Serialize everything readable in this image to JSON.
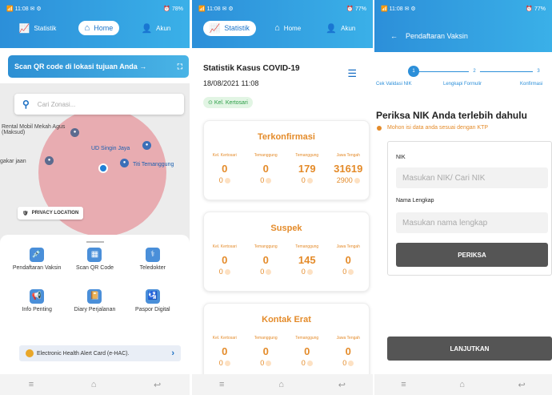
{
  "status": {
    "p1_left": "📶 11:08 ✉ ⚙",
    "p1_right": "⏰ 78%",
    "p2_left": "📶 11:08 ✉ ⚙",
    "p2_right": "⏰ 77%",
    "p3_left": "📶 11:08 ✉ ⚙",
    "p3_right": "⏰ 77%"
  },
  "nav": {
    "statistik": "Statistik",
    "home": "Home",
    "akun": "Akun"
  },
  "home": {
    "qr_label": "Scan QR code di lokasi tujuan Anda →",
    "search_placeholder": "Cari Zonasi...",
    "map_labels": [
      "Rental Mobil Mekah Agus (Maksud)",
      "UD Singin Jaya",
      "gakar jaan",
      "Titi Temanggung"
    ],
    "privacy": "PRIVACY LOCATION",
    "menu": [
      "Pendaftaran Vaksin",
      "Scan QR Code",
      "Teledokter",
      "Info Penting",
      "Diary Perjalanan",
      "Paspor Digital"
    ],
    "ehac": "Electronic Health Alert Card (e-HAC).",
    "ehac_arrow": "›"
  },
  "stats": {
    "title": "Statistik Kasus COVID-19",
    "date": "18/08/2021 11:08",
    "location": "Kel. Kertosari",
    "col_labels": [
      "Kel. Kertosari",
      "Temanggung",
      "Temanggung",
      "Jawa Tengah"
    ],
    "cards": [
      {
        "title": "Terkonfirmasi",
        "big": [
          "0",
          "0",
          "179",
          "31619"
        ],
        "small": [
          "0",
          "0",
          "0",
          "2900"
        ]
      },
      {
        "title": "Suspek",
        "big": [
          "0",
          "0",
          "145",
          "0"
        ],
        "small": [
          "0",
          "0",
          "0",
          "0"
        ]
      },
      {
        "title": "Kontak Erat",
        "big": [
          "0",
          "0",
          "0",
          "0"
        ],
        "small": [
          "0",
          "0",
          "0",
          "0"
        ]
      }
    ]
  },
  "vaksin": {
    "header": "Pendaftaran Vaksin",
    "steps": [
      "Cek Validasi NIK",
      "Lengkapi Formulir",
      "Konfirmasi"
    ],
    "step_nums": [
      "1",
      "2",
      "3"
    ],
    "heading": "Periksa NIK Anda terlebih dahulu",
    "note": "Mohon isi data anda sesuai dengan KTP",
    "nik_label": "NIK",
    "nik_placeholder": "Masukan NIK/ Cari NIK",
    "name_label": "Nama Lengkap",
    "name_placeholder": "Masukan nama lengkap",
    "periksa": "PERIKSA",
    "lanjutkan": "LANJUTKAN"
  },
  "bottom": {
    "menu": "≡",
    "home": "⌂",
    "back": "↩"
  }
}
